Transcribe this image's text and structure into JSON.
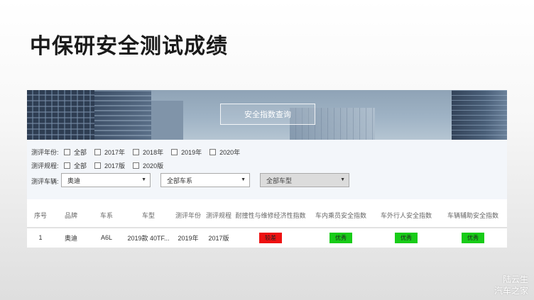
{
  "slide": {
    "title": "中保研安全测试成绩"
  },
  "banner": {
    "search_label": "安全指数查询"
  },
  "filters": {
    "year": {
      "label": "测评年份:",
      "options": [
        "全部",
        "2017年",
        "2018年",
        "2019年",
        "2020年"
      ]
    },
    "rule": {
      "label": "测评规程:",
      "options": [
        "全部",
        "2017版",
        "2020版"
      ]
    },
    "vehicle": {
      "label": "测评车辆:",
      "brand_selected": "奥迪",
      "series_selected": "全部车系",
      "model_selected": "全部车型"
    }
  },
  "table": {
    "headers": [
      "序号",
      "品牌",
      "车系",
      "车型",
      "测评年份",
      "测评规程",
      "耐撞性与维修经济性指数",
      "车内乘员安全指数",
      "车外行人安全指数",
      "车辆辅助安全指数"
    ],
    "rows": [
      {
        "no": "1",
        "brand": "奥迪",
        "series": "A6L",
        "model": "2019款 40TF...",
        "year": "2019年",
        "rule": "2017版",
        "crash": "较差",
        "occupant": "优秀",
        "pedestrian": "优秀",
        "assist": "优秀"
      }
    ]
  },
  "ratings_colors": {
    "较差": "#ee1111",
    "优秀": "#18cc18"
  },
  "watermark": {
    "line1": "陆云生",
    "line2": "汽车之家"
  }
}
